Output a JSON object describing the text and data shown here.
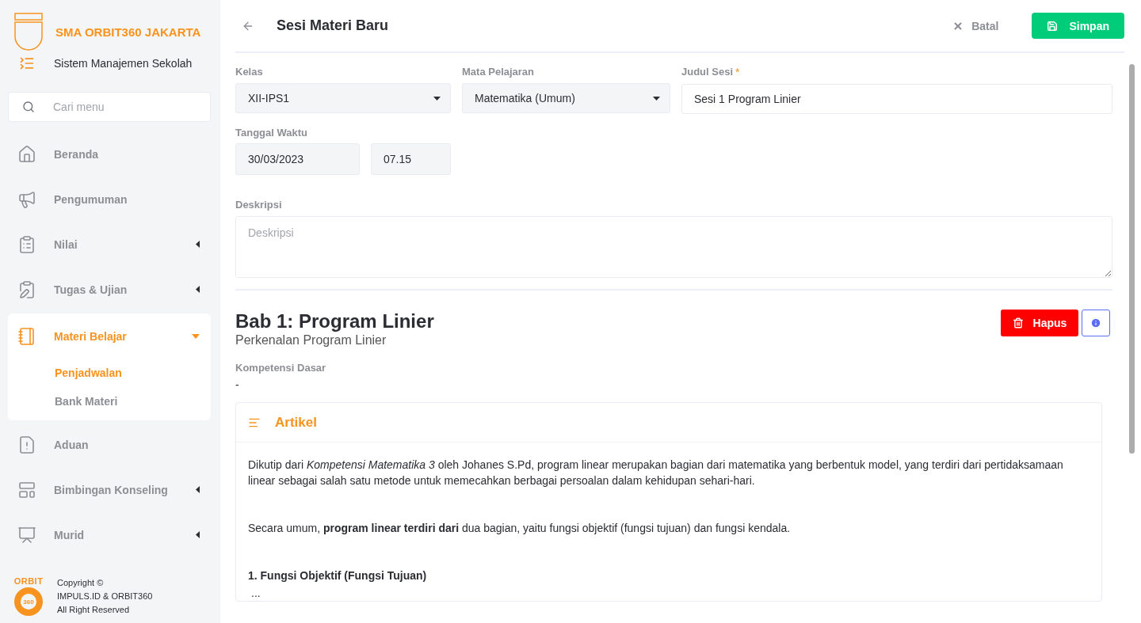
{
  "sidebar": {
    "school": "SMA ORBIT360 JAKARTA",
    "subtitle": "Sistem Manajemen Sekolah",
    "search": {
      "placeholder": "Cari menu"
    },
    "items": [
      {
        "label": "Beranda",
        "selected": false
      },
      {
        "label": "Pengumuman",
        "selected": false
      },
      {
        "label": "Nilai",
        "expanded": false,
        "selected": false
      },
      {
        "label": "Tugas & Ujian",
        "expanded": false,
        "selected": false
      },
      {
        "label": "Materi Belajar",
        "expanded": true,
        "selected": true,
        "children": [
          {
            "label": "Penjadwalan",
            "selected": true
          },
          {
            "label": "Bank Materi",
            "selected": false
          }
        ]
      },
      {
        "label": "Aduan",
        "selected": false
      },
      {
        "label": "Bimbingan Konseling",
        "expanded": false,
        "selected": false
      },
      {
        "label": "Murid",
        "expanded": false,
        "selected": false
      }
    ],
    "footer": {
      "logo_word": "ORBIT",
      "logo_number": "360",
      "lines": [
        "Copyright ©",
        "IMPULS.ID & ORBIT360",
        "All Right Reserved"
      ]
    }
  },
  "header": {
    "title": "Sesi Materi Baru",
    "cancel": "Batal",
    "save": "Simpan"
  },
  "form": {
    "kelas": {
      "label": "Kelas",
      "value": "XII-IPS1"
    },
    "mapel": {
      "label": "Mata Pelajaran",
      "value": "Matematika (Umum)"
    },
    "judul": {
      "label": "Judul Sesi",
      "required_mark": "*",
      "value": "Sesi 1 Program Linier"
    },
    "tanggal": {
      "label": "Tanggal Waktu",
      "date": "30/03/2023",
      "time": "07.15"
    },
    "deskripsi": {
      "label": "Deskripsi",
      "placeholder": "Deskripsi"
    }
  },
  "chapter": {
    "title": "Bab 1: Program Linier",
    "subtitle": "Perkenalan Program Linier",
    "delete": "Hapus",
    "kd_label": "Kompetensi Dasar",
    "kd_value": "-",
    "article": {
      "title": "Artikel",
      "blocks": [
        {
          "kind": "paragraph",
          "text": "Dikutip dari *Kompetensi Matematika 3* oleh Johanes S.Pd, program linear merupakan bagian dari matematika yang berbentuk model, yang terdiri dari pertidaksamaan linear sebagai salah satu metode untuk memecahkan berbagai persoalan dalam kehidupan sehari-hari."
        },
        {
          "kind": "paragraph",
          "text": "Secara umum, **program linear terdiri dari** dua bagian, yaitu fungsi objektif (fungsi tujuan) dan fungsi kendala."
        },
        {
          "kind": "heading",
          "text": "1. Fungsi Objektif (Fungsi Tujuan)"
        },
        {
          "kind": "ellipsis",
          "text": "..."
        }
      ]
    }
  }
}
